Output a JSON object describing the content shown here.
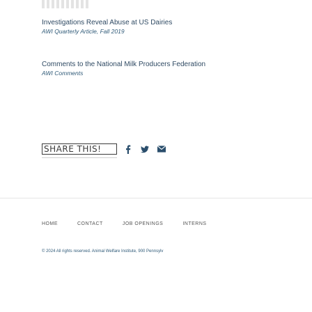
{
  "articles": [
    {
      "title": "Investigations Reveal Abuse at US Dairies",
      "meta": "AWI Quarterly Article, Fall 2019"
    },
    {
      "title": "Comments to the National Milk Producers Federation",
      "meta": "AWI Comments"
    }
  ],
  "share": {
    "label": "SHARE THIS!",
    "icons": [
      "facebook-icon",
      "twitter-icon",
      "email-icon"
    ],
    "icon_color": "#2a4e6c"
  },
  "footer": {
    "nav": [
      "HOME",
      "CONTACT",
      "JOB OPENINGS",
      "INTERNS"
    ],
    "copyright": "© 2024 All rights reserved. Animal Welfare Institute, 900 Pennsylv"
  }
}
